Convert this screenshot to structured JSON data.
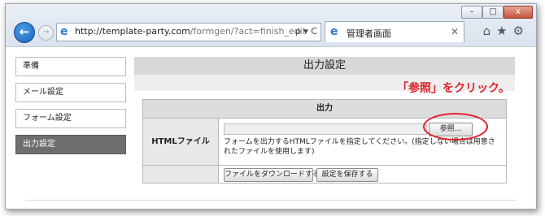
{
  "browser": {
    "url_host": "http://template-party.com",
    "url_path": "/formgen/?act=finish_edit",
    "address_tools": "ρ ▾ C",
    "tab_title": "管理者画面",
    "window_controls": [
      "–",
      "□",
      "x"
    ],
    "toolbar_icons": [
      "home-icon",
      "star-icon",
      "gear-icon"
    ]
  },
  "sidebar": {
    "items": [
      {
        "label": "準備"
      },
      {
        "label": "メール設定"
      },
      {
        "label": "フォーム設定"
      },
      {
        "label": "出力設定"
      }
    ]
  },
  "main": {
    "title": "出力設定",
    "table_header": "出力",
    "field_label": "HTMLファイル",
    "browse_label": "参照...",
    "help_text": "フォームを出力するHTMLファイルを指定してください。(指定しない場合は用意されたファイルを使用します)",
    "download_label": "ファイルをダウンロードする",
    "save_label": "設定を保存する"
  },
  "annotation": {
    "text": "「参照」をクリック。",
    "color": "#e0202a"
  }
}
